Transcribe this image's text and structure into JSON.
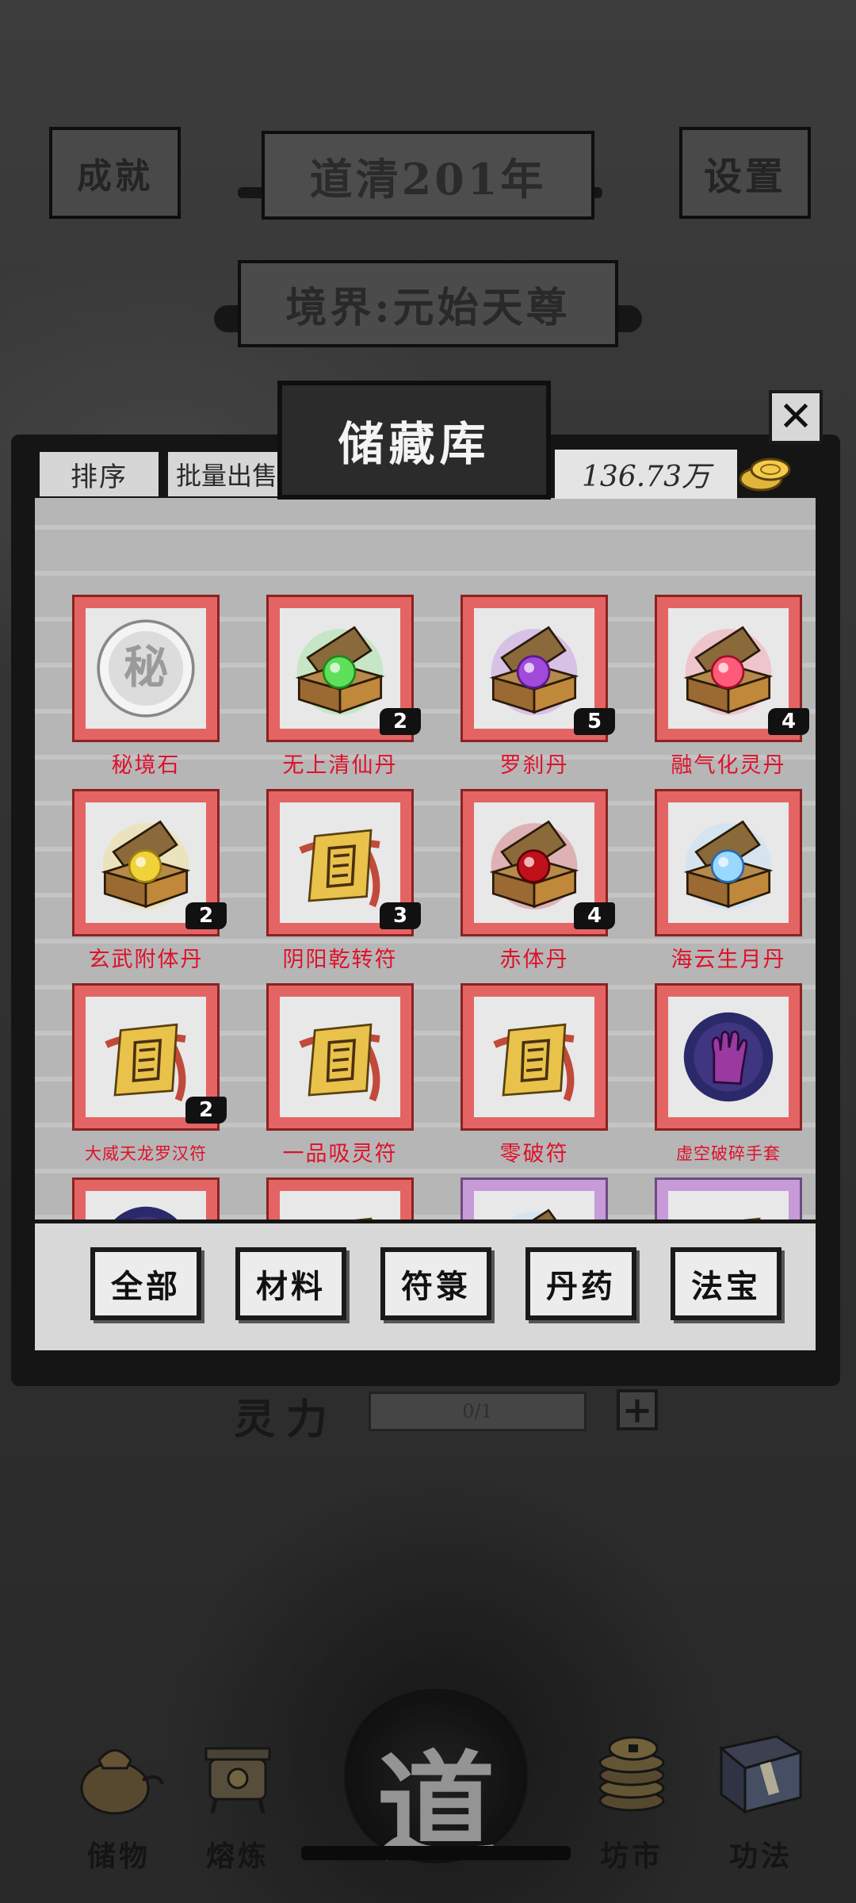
{
  "header": {
    "achievements_label": "成就",
    "year_label": "道清201年",
    "settings_label": "设置",
    "realm_label": "境界:元始天尊"
  },
  "storage": {
    "title": "储藏库",
    "sort_label": "排序",
    "bulk_sell_label": "批量出售",
    "coins": "136.73万",
    "close_icon": "close-icon",
    "items": [
      {
        "name": "秘境石",
        "count": "",
        "icon": "orb-seal-icon",
        "frame": "red"
      },
      {
        "name": "无上清仙丹",
        "count": "2",
        "icon": "chest-green-icon",
        "frame": "red"
      },
      {
        "name": "罗刹丹",
        "count": "5",
        "icon": "chest-purple-icon",
        "frame": "red"
      },
      {
        "name": "融气化灵丹",
        "count": "4",
        "icon": "chest-pink-icon",
        "frame": "red"
      },
      {
        "name": "玄武附体丹",
        "count": "2",
        "icon": "chest-yellow-icon",
        "frame": "red"
      },
      {
        "name": "阴阳乾转符",
        "count": "3",
        "icon": "talisman-icon",
        "frame": "red"
      },
      {
        "name": "赤体丹",
        "count": "4",
        "icon": "chest-red-icon",
        "frame": "red"
      },
      {
        "name": "海云生月丹",
        "count": "",
        "icon": "chest-blue-icon",
        "frame": "red"
      },
      {
        "name": "大威天龙罗汉符",
        "count": "2",
        "icon": "talisman-icon",
        "frame": "red"
      },
      {
        "name": "一品吸灵符",
        "count": "",
        "icon": "talisman-icon",
        "frame": "red"
      },
      {
        "name": "零破符",
        "count": "",
        "icon": "talisman-icon",
        "frame": "red"
      },
      {
        "name": "虚空破碎手套",
        "count": "",
        "icon": "glove-icon",
        "frame": "red"
      },
      {
        "name": "",
        "count": "",
        "icon": "glove-icon",
        "frame": "red"
      },
      {
        "name": "",
        "count": "",
        "icon": "talisman-icon",
        "frame": "red"
      },
      {
        "name": "",
        "count": "",
        "icon": "chest-blue-icon",
        "frame": "purple"
      },
      {
        "name": "",
        "count": "",
        "icon": "talisman-icon",
        "frame": "purple"
      }
    ],
    "filters": [
      "全部",
      "材料",
      "符箓",
      "丹药",
      "法宝"
    ]
  },
  "background": {
    "spirit_label": "灵力",
    "spirit_value": "0/1",
    "plus_label": "+"
  },
  "nav": {
    "storage": "储物",
    "smelt": "熔炼",
    "center": "道",
    "market": "坊市",
    "skills": "功法"
  }
}
